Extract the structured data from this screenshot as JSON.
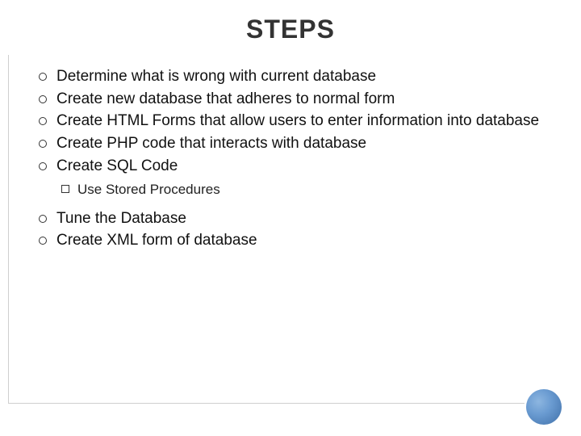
{
  "title": "STEPS",
  "bullets_group1": [
    "Determine what is wrong with current database",
    "Create new database that adheres to normal form",
    "Create HTML Forms that allow users to enter information into database",
    "Create PHP code that interacts with database",
    "Create SQL Code"
  ],
  "sub_bullets": [
    "Use Stored Procedures"
  ],
  "bullets_group2": [
    "Tune the Database",
    "Create XML form of database"
  ]
}
